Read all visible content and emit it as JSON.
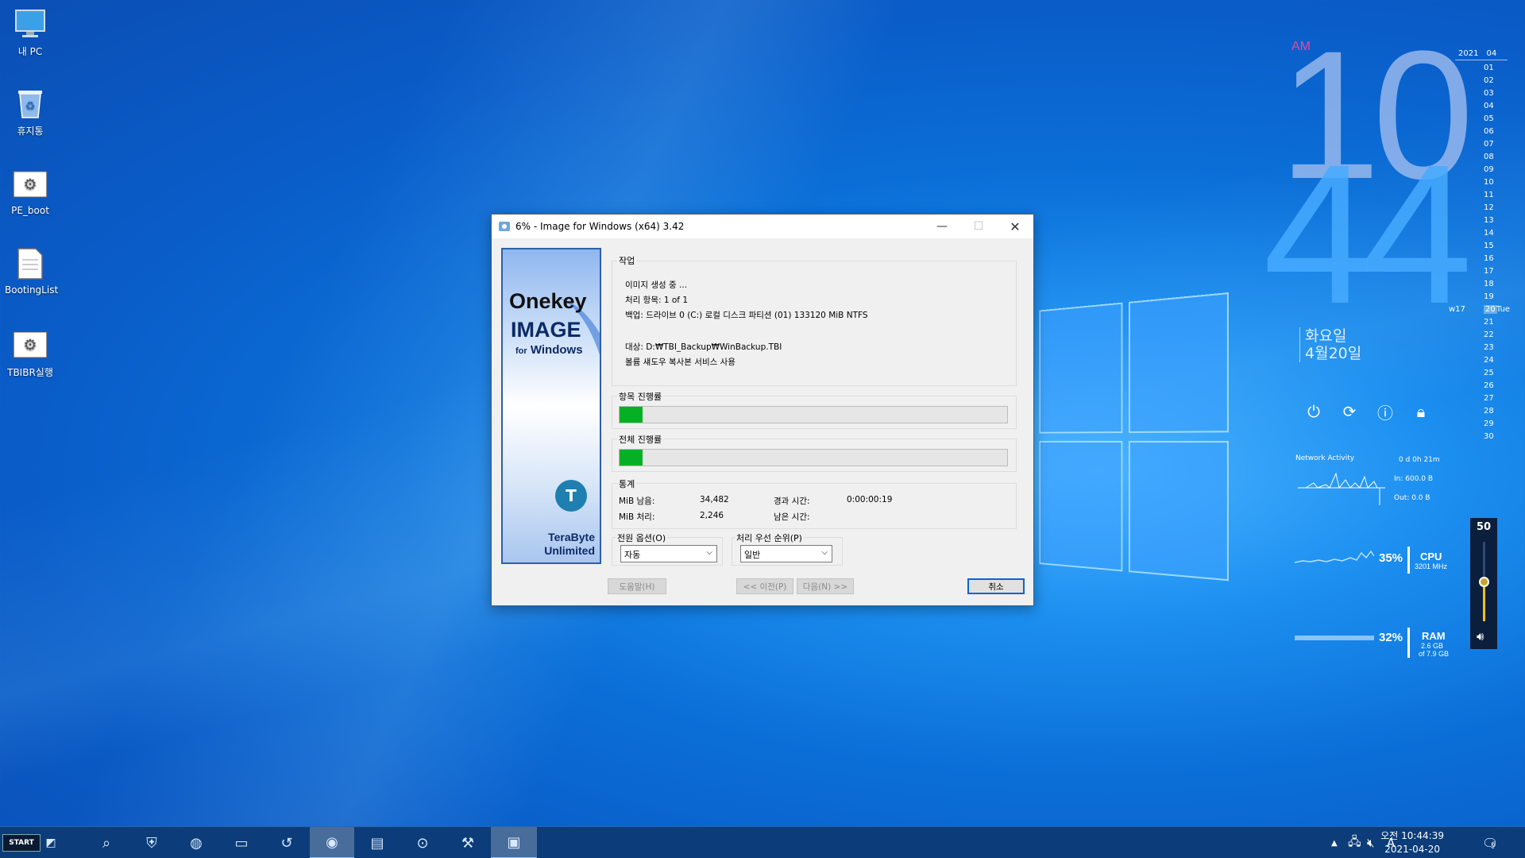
{
  "desktop": {
    "icons": [
      {
        "label": "내 PC",
        "icon": "monitor-icon"
      },
      {
        "label": "휴지통",
        "icon": "recycle-bin-icon"
      },
      {
        "label": "PE_boot",
        "icon": "settings-shortcut-icon"
      },
      {
        "label": "BootingList",
        "icon": "document-icon"
      },
      {
        "label": "TBIBR실행",
        "icon": "settings-shortcut-icon"
      }
    ]
  },
  "window": {
    "title": "6% - Image for Windows (x64) 3.42",
    "banner": {
      "line1": "Onekey",
      "line2": "IMAGE",
      "line3_for": "for",
      "line3_win": "Windows",
      "company1": "TeraByte",
      "company2": "Unlimited"
    },
    "task_group": {
      "label": "작업",
      "lines": [
        "이미지 생성 중 ...",
        "처리 항목: 1 of 1",
        "백업: 드라이브 0 (C:) 로컬 디스크 파티션 (01) 133120 MiB NTFS",
        "대상: D:₩TBI_Backup₩WinBackup.TBI",
        "볼륨 섀도우 복사본 서비스 사용"
      ]
    },
    "item_progress": {
      "label": "항목 진행률",
      "percent": 6
    },
    "total_progress": {
      "label": "전체 진행률",
      "percent": 6
    },
    "stats": {
      "label": "통계",
      "remaining_label": "MiB 남음:",
      "remaining_value": "34,482",
      "processed_label": "MiB 처리:",
      "processed_value": "2,246",
      "elapsed_label": "경과 시간:",
      "elapsed_value": "0:00:00:19",
      "left_label": "남은 시간:",
      "left_value": ""
    },
    "power_option": {
      "label": "전원 옵션(O)",
      "value": "자동"
    },
    "priority": {
      "label": "처리 우선 순위(P)",
      "value": "일반"
    },
    "buttons": {
      "help": "도움말(H)",
      "prev": "<< 이전(P)",
      "next": "다음(N) >>",
      "cancel": "취소"
    }
  },
  "widget": {
    "ampm": "AM",
    "hour": "10",
    "minute": "44",
    "day_name": "화요일",
    "date_k": "4월20일",
    "calendar": {
      "year": "2021",
      "month": "04",
      "week": "w17",
      "weekday": "Tue",
      "today": "20",
      "days": [
        "01",
        "02",
        "03",
        "04",
        "05",
        "06",
        "07",
        "08",
        "09",
        "10",
        "11",
        "12",
        "13",
        "14",
        "15",
        "16",
        "17",
        "18",
        "19",
        "20",
        "21",
        "22",
        "23",
        "24",
        "25",
        "26",
        "27",
        "28",
        "29",
        "30"
      ]
    },
    "network": {
      "title": "Network Activity",
      "uptime": "0 d 0h 21m",
      "in": "In: 600.0 B",
      "out": "Out: 0.0 B"
    },
    "cpu": {
      "percent": "35%",
      "label": "CPU",
      "sub": "3201 MHz"
    },
    "ram": {
      "percent": "32%",
      "label": "RAM",
      "sub1": "2.6 GB",
      "sub2": "of 7.9 GB"
    },
    "volume": {
      "level": "50"
    }
  },
  "taskbar": {
    "start_label": "START",
    "tray_clock_time": "오전 10:44:39",
    "tray_clock_date": "2021-04-20",
    "ime": "A",
    "notif_count": "6"
  }
}
